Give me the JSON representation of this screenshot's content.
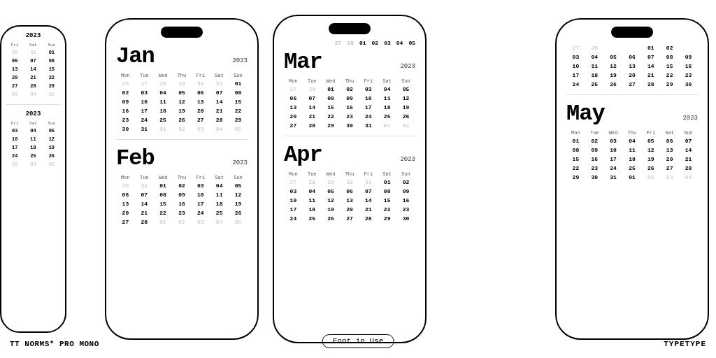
{
  "brand": {
    "left_label": "TT NORMS* PRO MONO",
    "right_label": "TYPETYPE",
    "center_label": "Font in Use"
  },
  "phones": {
    "left_partial": {
      "year1": "2023",
      "days_header": [
        "Fri",
        "Sat",
        "Sun"
      ],
      "weeks1": [
        [
          "30",
          "31",
          "01"
        ],
        [
          "06",
          "07",
          "08"
        ],
        [
          "13",
          "14",
          "15"
        ],
        [
          "20",
          "21",
          "22"
        ],
        [
          "27",
          "28",
          "29"
        ],
        [
          "03",
          "04",
          "05"
        ]
      ],
      "dim_rows1": [
        5
      ],
      "year2": "2023",
      "weeks2": [
        [
          "03",
          "04",
          "05"
        ],
        [
          "10",
          "11",
          "12"
        ],
        [
          "17",
          "18",
          "19"
        ],
        [
          "24",
          "25",
          "26"
        ],
        [
          "03",
          "04",
          "05"
        ]
      ],
      "dim_rows2": [
        4
      ]
    },
    "center_left": {
      "months": [
        {
          "name": "Jan",
          "year": "2023",
          "days_header": [
            "Mon",
            "Tue",
            "Wed",
            "Thu",
            "Fri",
            "Sat",
            "Sun"
          ],
          "weeks": [
            [
              "26",
              "27",
              "28",
              "29",
              "30",
              "31",
              "01"
            ],
            [
              "02",
              "03",
              "04",
              "05",
              "06",
              "07",
              "08"
            ],
            [
              "09",
              "10",
              "11",
              "12",
              "13",
              "14",
              "15"
            ],
            [
              "16",
              "17",
              "18",
              "19",
              "20",
              "21",
              "22"
            ],
            [
              "23",
              "24",
              "25",
              "26",
              "27",
              "28",
              "29"
            ],
            [
              "30",
              "31",
              "01",
              "02",
              "03",
              "04",
              "05"
            ]
          ],
          "dim_first": 6,
          "dim_last": 5
        },
        {
          "name": "Feb",
          "year": "2023",
          "days_header": [
            "Mon",
            "Tue",
            "Wed",
            "Thu",
            "Fri",
            "Sat",
            "Sun"
          ],
          "weeks": [
            [
              "30",
              "31",
              "01",
              "02",
              "03",
              "04",
              "05"
            ],
            [
              "06",
              "07",
              "08",
              "09",
              "10",
              "11",
              "12"
            ],
            [
              "13",
              "14",
              "15",
              "16",
              "17",
              "18",
              "19"
            ],
            [
              "20",
              "21",
              "22",
              "23",
              "24",
              "25",
              "26"
            ],
            [
              "27",
              "28",
              "01",
              "02",
              "03",
              "04",
              "05"
            ]
          ],
          "dim_first": 2,
          "dim_last": 5
        }
      ]
    },
    "center": {
      "months": [
        {
          "name": "Mar",
          "year": "2023",
          "days_header": [
            "Mon",
            "Tue",
            "Wed",
            "Thu",
            "Fri",
            "Sat",
            "Sun"
          ],
          "weeks": [
            [
              "27",
              "28",
              "01",
              "02",
              "03",
              "04",
              "05"
            ],
            [
              "06",
              "07",
              "08",
              "09",
              "10",
              "11",
              "12"
            ],
            [
              "13",
              "14",
              "15",
              "16",
              "17",
              "18",
              "19"
            ],
            [
              "20",
              "21",
              "22",
              "23",
              "24",
              "25",
              "26"
            ],
            [
              "27",
              "28",
              "29",
              "30",
              "31",
              "01",
              "02"
            ]
          ],
          "dim_first": 2,
          "dim_last": 2
        },
        {
          "name": "Apr",
          "year": "2023",
          "days_header": [
            "Mon",
            "Tue",
            "Wed",
            "Thu",
            "Fri",
            "Sat",
            "Sun"
          ],
          "weeks": [
            [
              "27",
              "28",
              "29",
              "30",
              "31",
              "01",
              "02"
            ],
            [
              "03",
              "04",
              "05",
              "06",
              "07",
              "08",
              "09"
            ],
            [
              "10",
              "11",
              "12",
              "13",
              "14",
              "15",
              "16"
            ],
            [
              "17",
              "18",
              "19",
              "20",
              "21",
              "22",
              "23"
            ],
            [
              "24",
              "25",
              "26",
              "27",
              "28",
              "29",
              "30"
            ]
          ],
          "dim_first": 5,
          "dim_last": 0
        }
      ]
    },
    "right": {
      "top_rows": [
        [
          "27",
          "28",
          "",
          "",
          "01",
          "02"
        ],
        [
          "03",
          "04",
          "05",
          "06",
          "07",
          "08",
          "09"
        ],
        [
          "10",
          "11",
          "12",
          "13",
          "14",
          "15",
          "16"
        ],
        [
          "17",
          "18",
          "19",
          "20",
          "21",
          "22",
          "23"
        ],
        [
          "24",
          "25",
          "26",
          "27",
          "28",
          "29",
          "30"
        ]
      ],
      "months": [
        {
          "name": "May",
          "year": "2023",
          "days_header": [
            "Mon",
            "Tue",
            "Wed",
            "Thu",
            "Fri",
            "Sat",
            "Sun"
          ],
          "weeks": [
            [
              "01",
              "02",
              "03",
              "04",
              "05",
              "06",
              "07"
            ],
            [
              "08",
              "09",
              "10",
              "11",
              "12",
              "13",
              "14"
            ],
            [
              "15",
              "16",
              "17",
              "18",
              "19",
              "20",
              "21"
            ],
            [
              "22",
              "23",
              "24",
              "25",
              "26",
              "27",
              "28"
            ],
            [
              "29",
              "30",
              "31",
              "01",
              "02",
              "03",
              "04"
            ]
          ],
          "dim_first": 0,
          "dim_last": 3
        }
      ]
    }
  }
}
